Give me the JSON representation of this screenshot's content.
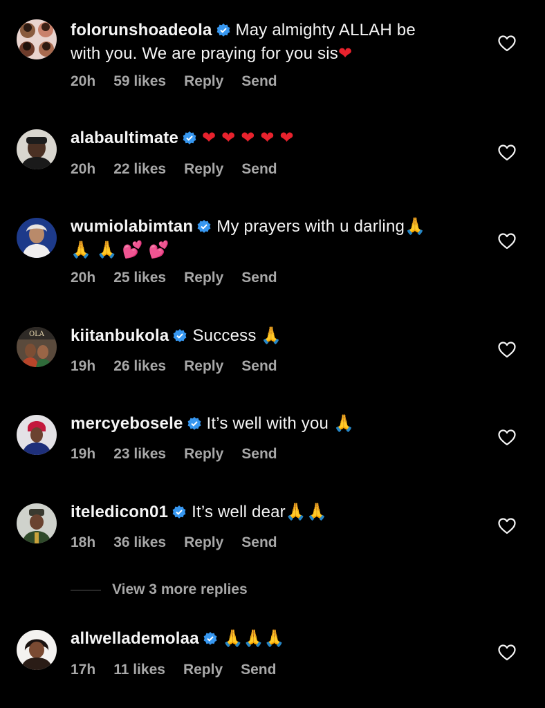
{
  "colors": {
    "background": "#000000",
    "text": "#f5f5f5",
    "meta": "#a8a8a8",
    "verified": "#3797f0"
  },
  "comments": [
    {
      "username": "folorunshoadeola",
      "text_line1": "May almighty ALLAH be",
      "text_line2": "with you. We are praying for you sis",
      "emoji_line2": "❤",
      "time": "20h",
      "likes": "59 likes",
      "reply": "Reply",
      "send": "Send"
    },
    {
      "username": "alabaultimate",
      "text_line1": "",
      "emoji_line1": "❤ ❤ ❤ ❤ ❤",
      "time": "20h",
      "likes": "22 likes",
      "reply": "Reply",
      "send": "Send"
    },
    {
      "username": "wumiolabimtan",
      "text_line1": "My prayers with u darling",
      "emoji_line1": "🙏",
      "emoji_line2a": "🙏 🙏",
      "emoji_line2b": "💕 💕",
      "time": "20h",
      "likes": "25 likes",
      "reply": "Reply",
      "send": "Send"
    },
    {
      "username": "kiitanbukola",
      "text_line1": "Success",
      "emoji_line1": "🙏",
      "time": "19h",
      "likes": "26 likes",
      "reply": "Reply",
      "send": "Send"
    },
    {
      "username": "mercyebosele",
      "text_line1": "It’s well with you",
      "emoji_line1": "🙏",
      "time": "19h",
      "likes": "23 likes",
      "reply": "Reply",
      "send": "Send"
    },
    {
      "username": "iteledicon01",
      "text_line1": "It’s well dear",
      "emoji_line1": "🙏🙏",
      "time": "18h",
      "likes": "36 likes",
      "reply": "Reply",
      "send": "Send"
    },
    {
      "username": "allwellademolaa",
      "text_line1": "",
      "emoji_line1": "🙏🙏🙏",
      "time": "17h",
      "likes": "11 likes",
      "reply": "Reply",
      "send": "Send"
    }
  ],
  "view_more_replies": "View 3 more replies",
  "icons": {
    "like": "heart-outline-icon",
    "verified": "verified-badge-icon"
  }
}
